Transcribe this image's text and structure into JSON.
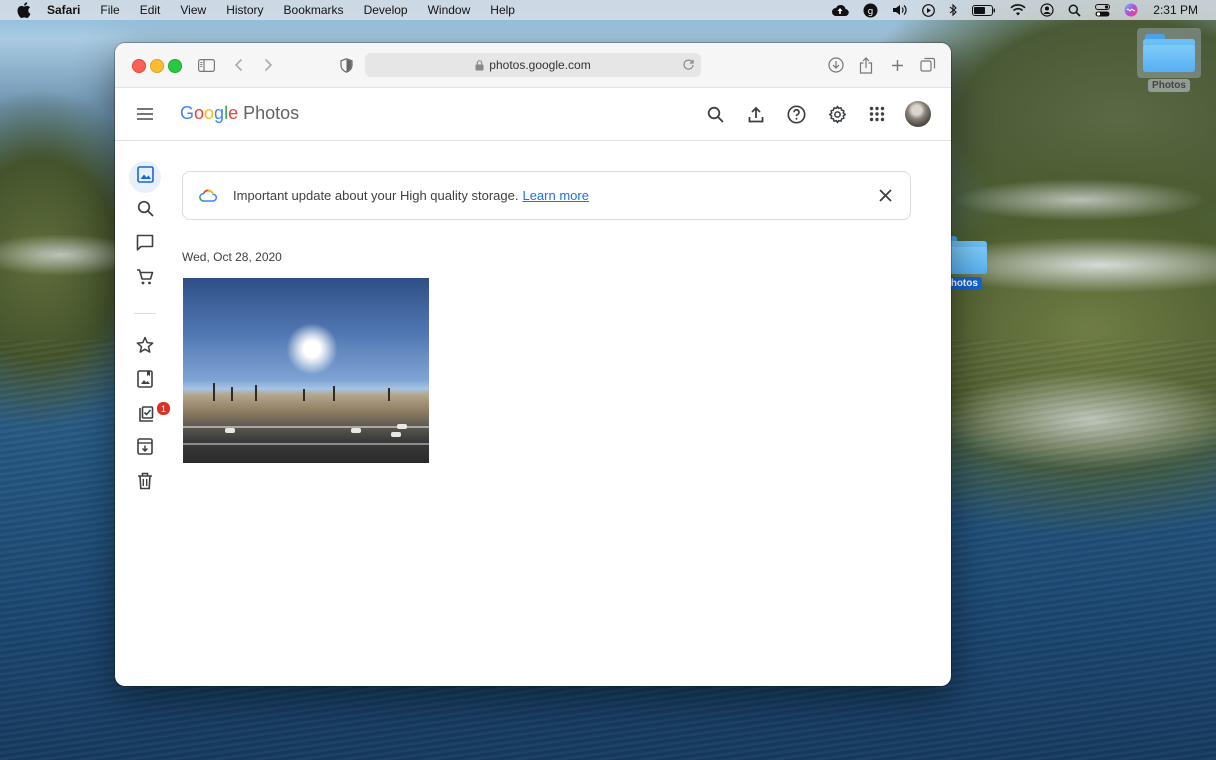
{
  "menubar": {
    "app": "Safari",
    "items": [
      "File",
      "Edit",
      "View",
      "History",
      "Bookmarks",
      "Develop",
      "Window",
      "Help"
    ],
    "clock": "2:31 PM"
  },
  "desktop": {
    "icon_top_label": "Photos",
    "icon_drag_label": "Photos"
  },
  "browser": {
    "url": "photos.google.com"
  },
  "gp": {
    "logo_letters": [
      "G",
      "o",
      "o",
      "g",
      "l",
      "e"
    ],
    "product": "Photos",
    "notice_text": "Important update about your High quality storage.",
    "notice_link": "Learn more",
    "date_heading": "Wed, Oct 28, 2020",
    "badge_count": "1"
  },
  "colors": {
    "google_blue": "#4285f4",
    "google_red": "#ea4335",
    "google_yellow": "#fbbc05",
    "google_green": "#34a853",
    "link": "#1a73e8",
    "active_nav_bg": "#e8f0fe",
    "badge": "#d93025"
  },
  "icons": {
    "menubar_status": [
      "cloud-upload-icon",
      "accessibility-icon",
      "volume-icon",
      "play-icon",
      "bluetooth-icon",
      "battery-icon",
      "wifi-icon",
      "user-icon",
      "search-icon",
      "control-center-icon",
      "siri-icon"
    ],
    "sidenav": [
      "photos-icon",
      "search-icon",
      "sharing-icon",
      "shop-icon",
      "favorites-icon",
      "library-icon",
      "utilities-icon",
      "archive-icon",
      "trash-icon"
    ]
  }
}
